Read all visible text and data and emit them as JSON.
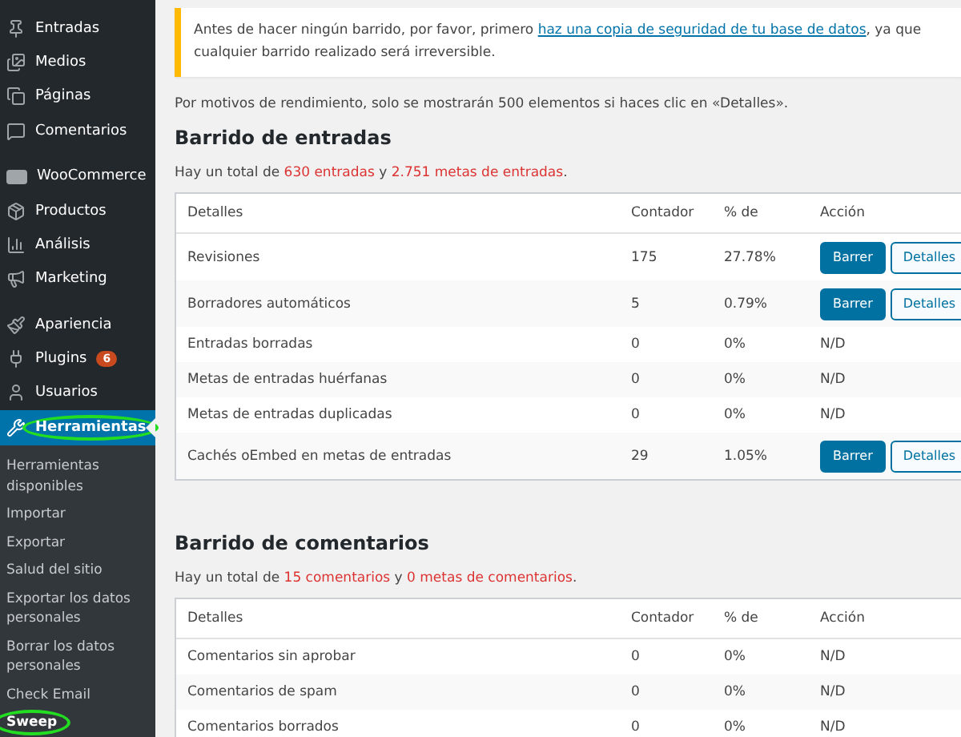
{
  "sidebar": {
    "items": [
      {
        "label": "Entradas",
        "selected": false,
        "circled": false
      },
      {
        "label": "Medios",
        "selected": false,
        "circled": false
      },
      {
        "label": "Páginas",
        "selected": false,
        "circled": false
      },
      {
        "label": "Comentarios",
        "selected": false,
        "circled": false
      },
      {
        "label": "WooCommerce",
        "selected": false,
        "circled": false
      },
      {
        "label": "Productos",
        "selected": false,
        "circled": false
      },
      {
        "label": "Análisis",
        "selected": false,
        "circled": false
      },
      {
        "label": "Marketing",
        "selected": false,
        "circled": false
      },
      {
        "label": "Apariencia",
        "selected": false,
        "circled": false
      },
      {
        "label": "Plugins",
        "selected": false,
        "circled": false,
        "badge": "6"
      },
      {
        "label": "Usuarios",
        "selected": false,
        "circled": false
      },
      {
        "label": "Herramientas",
        "selected": true,
        "circled": true
      }
    ],
    "submenu": [
      {
        "label": "Herramientas disponibles",
        "selected": false,
        "circled": false
      },
      {
        "label": "Importar",
        "selected": false,
        "circled": false
      },
      {
        "label": "Exportar",
        "selected": false,
        "circled": false
      },
      {
        "label": "Salud del sitio",
        "selected": false,
        "circled": false
      },
      {
        "label": "Exportar los datos personales",
        "selected": false,
        "circled": false
      },
      {
        "label": "Borrar los datos personales",
        "selected": false,
        "circled": false
      },
      {
        "label": "Check Email",
        "selected": false,
        "circled": false
      },
      {
        "label": "Sweep",
        "selected": true,
        "circled": true
      }
    ]
  },
  "notice": {
    "before": "Antes de hacer ningún barrido, por favor, primero ",
    "link": "haz una copia de seguridad de tu base de datos",
    "after": ", ya que cualquier barrido realizado será irreversible."
  },
  "info": "Por motivos de rendimiento, solo se mostrarán 500 elementos si haces clic en «Detalles».",
  "sections": [
    {
      "title": "Barrido de entradas",
      "summary": "Hay un total de **630 entradas** y **2.751 metas de entradas**.",
      "columns": [
        "Detalles",
        "Contador",
        "% de",
        "Acción"
      ],
      "rows": [
        {
          "detail": "Revisiones",
          "count": "175",
          "percent": "27.78%",
          "kind": "buttons",
          "actions": [
            "Barrer",
            "Detalles"
          ]
        },
        {
          "detail": "Borradores automáticos",
          "count": "5",
          "percent": "0.79%",
          "kind": "buttons",
          "actions": [
            "Barrer",
            "Detalles"
          ]
        },
        {
          "detail": "Entradas borradas",
          "count": "0",
          "percent": "0%",
          "kind": "text",
          "action": "N/D"
        },
        {
          "detail": "Metas de entradas huérfanas",
          "count": "0",
          "percent": "0%",
          "kind": "text",
          "action": "N/D"
        },
        {
          "detail": "Metas de entradas duplicadas",
          "count": "0",
          "percent": "0%",
          "kind": "text",
          "action": "N/D"
        },
        {
          "detail": "Cachés oEmbed en metas de entradas",
          "count": "29",
          "percent": "1.05%",
          "kind": "buttons",
          "actions": [
            "Barrer",
            "Detalles"
          ]
        }
      ]
    },
    {
      "title": "Barrido de comentarios",
      "summary": "Hay un total de **15 comentarios** y **0 metas de comentarios**.",
      "columns": [
        "Detalles",
        "Contador",
        "% de",
        "Acción"
      ],
      "rows": [
        {
          "detail": "Comentarios sin aprobar",
          "count": "0",
          "percent": "0%",
          "kind": "text",
          "action": "N/D"
        },
        {
          "detail": "Comentarios de spam",
          "count": "0",
          "percent": "0%",
          "kind": "text",
          "action": "N/D"
        },
        {
          "detail": "Comentarios borrados",
          "count": "0",
          "percent": "0%",
          "kind": "text",
          "action": "N/D"
        }
      ]
    }
  ]
}
